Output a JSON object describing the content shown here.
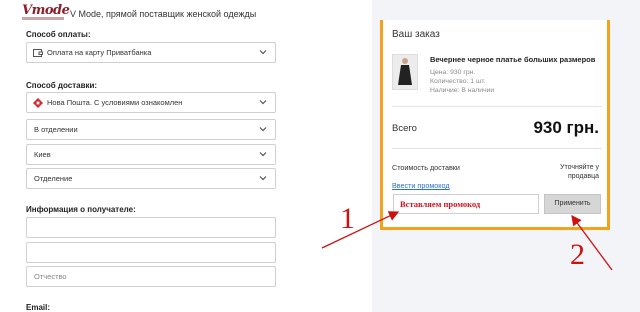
{
  "header": {
    "logo_text": "Vmode",
    "site_title": "V Mode, прямой поставщик женской одежды"
  },
  "form": {
    "payment_label": "Способ оплаты:",
    "payment_value": "Оплата на карту Приватбанка",
    "delivery_label": "Способ доставки:",
    "delivery_value": "Нова Пошта. С условиями ознакомлен",
    "delivery_type_value": "В отделении",
    "city_value": "Киев",
    "branch_value": "Отделение",
    "recipient_label": "Информация о получателе:",
    "field1_placeholder": "",
    "field2_placeholder": "",
    "patronymic_placeholder": "Отчество",
    "email_label": "Email:"
  },
  "order": {
    "title": "Ваш заказ",
    "product_name": "Вечернее черное платье больших размеров",
    "price_line": "Цена: 930 грн.",
    "qty_line": "Количество: 1 шт.",
    "stock_line": "Наличие: В наличии",
    "total_label": "Всего",
    "total_value": "930 грн.",
    "shipping_label": "Стоимость доставки",
    "shipping_value_1": "Уточняйте у",
    "shipping_value_2": "продавца",
    "promo_link": "Ввести промокод",
    "promo_input_value": "Вставляем промокод",
    "apply_label": "Применить"
  },
  "annotations": {
    "marker_1": "1",
    "marker_2": "2",
    "color": "#cc1111"
  },
  "colors": {
    "accent_border": "#f2a31b",
    "link": "#2a6fd0",
    "right_bg": "#f3f4f8"
  },
  "icons": [
    "chevron-down-icon",
    "card-icon",
    "nova-poshta-icon"
  ]
}
